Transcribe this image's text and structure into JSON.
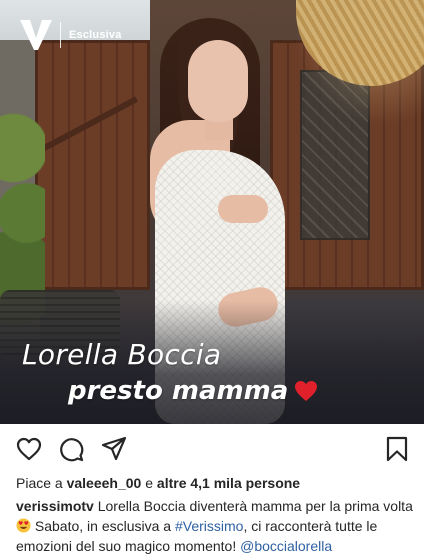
{
  "post": {
    "brand_tag": "Esclusiva",
    "headline": "Lorella Boccia",
    "subline": "presto mamma"
  },
  "actions": {
    "icons": [
      "heart-icon",
      "comment-icon",
      "share-icon",
      "bookmark-icon"
    ]
  },
  "likes": {
    "prefix": "Piace a ",
    "user": "valeeeh_00",
    "middle": " e ",
    "others": "altre 4,1 mila persone"
  },
  "caption": {
    "username": "verissimotv",
    "text_1": " Lorella Boccia diventerà mamma per la prima volta ",
    "text_2": " Sabato, in esclusiva a ",
    "hashtag": "#Verissimo",
    "text_3": ", ci racconterà tutte le emozioni del suo magico momento! ",
    "mention": "@boccialorella"
  },
  "colors": {
    "link": "#2e61a3",
    "heart": "#e0202a",
    "text": "#262626"
  }
}
